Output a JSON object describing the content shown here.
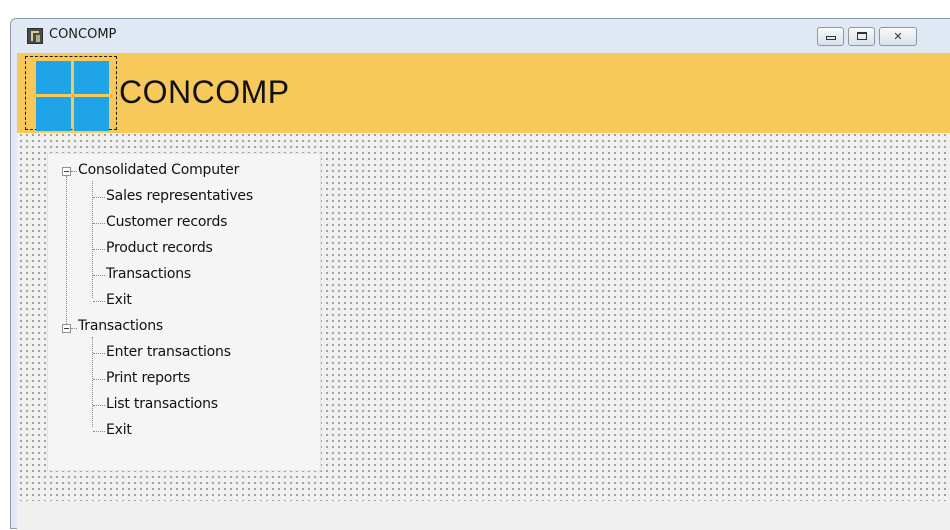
{
  "window": {
    "title": "CONCOMP",
    "controls": {
      "minimize": "minimize-icon",
      "maximize": "maximize-icon",
      "close": "✕"
    }
  },
  "header": {
    "logo_icon": "windows-logo-icon",
    "heading": "CONCOMP",
    "accent_color": "#f7c95b",
    "logo_color": "#1fa4e8"
  },
  "tree": {
    "groups": [
      {
        "label": "Consolidated Computer",
        "expanded": true,
        "items": [
          "Sales representatives",
          "Customer records",
          "Product records",
          "Transactions",
          "Exit"
        ]
      },
      {
        "label": "Transactions",
        "expanded": true,
        "items": [
          "Enter transactions",
          "Print reports",
          "List transactions",
          "Exit"
        ]
      }
    ]
  }
}
